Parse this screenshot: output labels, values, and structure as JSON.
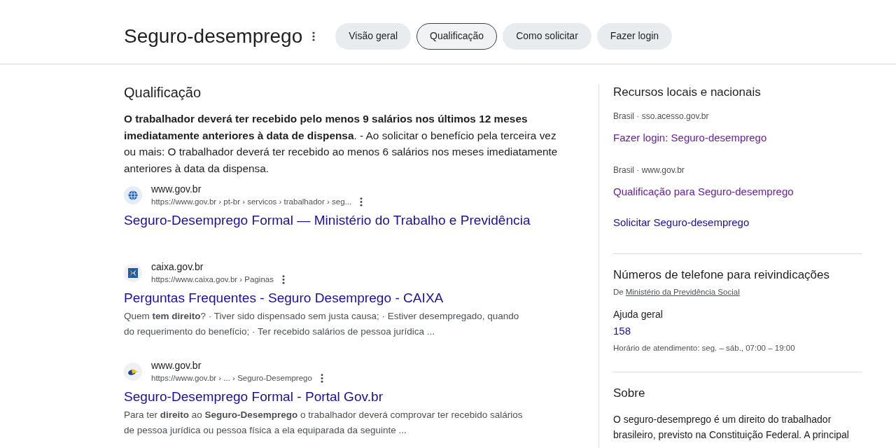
{
  "header": {
    "title": "Seguro-desemprego",
    "chips": [
      {
        "label": "Visão geral",
        "selected": false
      },
      {
        "label": "Qualificação",
        "selected": true
      },
      {
        "label": "Como solicitar",
        "selected": false
      },
      {
        "label": "Fazer login",
        "selected": false
      }
    ]
  },
  "main": {
    "heading": "Qualificação",
    "answer": "**O trabalhador deverá ter recebido pelo menos 9 salários nos últimos 12 meses imediatamente anteriores à data de dispensa**. - Ao solicitar o benefício pela terceira vez ou mais: O trabalhador deverá ter recebido ao menos 6 salários nos meses imediatamente anteriores à data da dispensa.",
    "results": [
      {
        "kind": "globe",
        "site": "www.gov.br",
        "url": "https://www.gov.br › pt-br › servicos › trabalhador › seg...",
        "title": "Seguro-Desemprego Formal — Ministério do Trabalho e Previdência",
        "visited": false
      },
      {
        "kind": "tile",
        "site": "caixa.gov.br",
        "url": "https://www.caixa.gov.br › Paginas",
        "title": "Perguntas Frequentes - Seguro Desemprego - CAIXA",
        "snippet": "Quem **tem direito**? · Tiver sido dispensado sem justa causa; · Estiver desempregado, quando do requerimento do benefício; · Ter recebido salários de pessoa jurídica ...",
        "visited": false
      },
      {
        "kind": "emblem",
        "site": "www.gov.br",
        "url": "https://www.gov.br › ... › Seguro-Desemprego",
        "title": "Seguro-Desemprego Formal - Portal Gov.br",
        "snippet": "Para ter **direito** ao **Seguro-Desemprego** o trabalhador deverá comprovar ter recebido salários de pessoa jurídica ou pessoa física a ela equiparada da seguinte ...",
        "visited": false
      }
    ]
  },
  "sidebar": {
    "resources": {
      "title": "Recursos locais e nacionais",
      "groups": [
        {
          "source": "Brasil · sso.acesso.gov.br",
          "links": [
            {
              "label": "Fazer login: Seguro-desemprego",
              "visited": true
            }
          ]
        },
        {
          "source": "Brasil · www.gov.br",
          "links": [
            {
              "label": "Qualificação para Seguro-desemprego",
              "visited": true
            },
            {
              "label": "Solicitar Seguro-desemprego",
              "visited": false
            }
          ]
        }
      ]
    },
    "phones": {
      "title": "Números de telefone para reivindicações",
      "source_prefix": "De",
      "source_link": "Ministério da Previdência Social",
      "entries": [
        {
          "label": "Ajuda geral",
          "number": "158",
          "hours": "Horário de atendimento: seg. – sáb., 07:00 – 19:00"
        }
      ]
    },
    "about": {
      "title": "Sobre",
      "text": "O seguro-desemprego é um direito do trabalhador brasileiro, previsto na Constituição Federal. A principal"
    }
  }
}
